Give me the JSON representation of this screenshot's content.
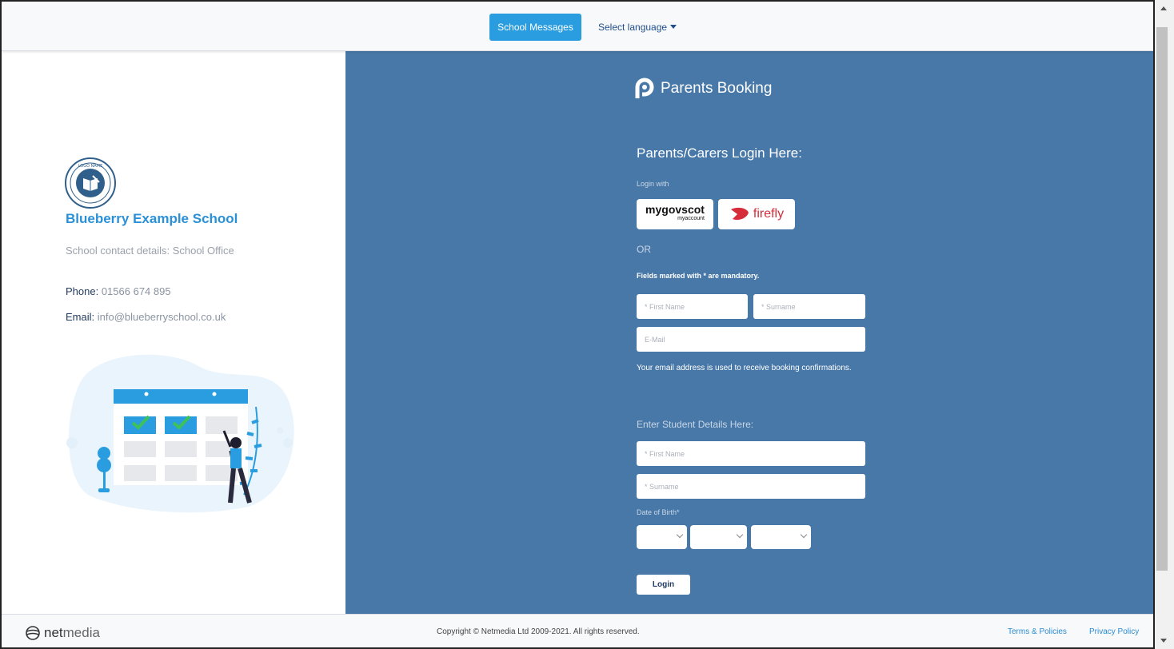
{
  "topbar": {
    "messages_label": "School Messages",
    "language_label": "Select language"
  },
  "school": {
    "name": "Blueberry Example School",
    "contact": "School contact details: School Office",
    "phone_label": "Phone:",
    "phone": "01566 674 895",
    "email_label": "Email:",
    "email": "info@blueberryschool.co.uk",
    "logo_text": "LOGO NAME"
  },
  "login": {
    "brand": "Parents Booking",
    "title": "Parents/Carers Login Here:",
    "login_with": "Login with",
    "sso_mygov": "mygovscot",
    "sso_mygov_sub": "myaccount",
    "sso_firefly": "firefly",
    "or": "OR",
    "mandatory": "Fields marked with * are mandatory.",
    "parent_first_placeholder": "* First Name",
    "parent_surname_placeholder": "* Surname",
    "email_placeholder": "E-Mail",
    "email_note": "Your email address is used to receive booking confirmations.",
    "student_heading": "Enter Student Details Here:",
    "student_first_placeholder": "* First Name",
    "student_surname_placeholder": "* Surname",
    "dob_label": "Date of Birth*",
    "login_button": "Login"
  },
  "footer": {
    "brand_bold": "net",
    "brand_light": "media",
    "copyright": "Copyright © Netmedia Ltd 2009-2021. All rights reserved.",
    "terms": "Terms & Policies",
    "privacy": "Privacy Policy"
  },
  "colors": {
    "accent": "#2a9de0",
    "panel": "#4878a8",
    "school_name": "#2a90d8"
  }
}
